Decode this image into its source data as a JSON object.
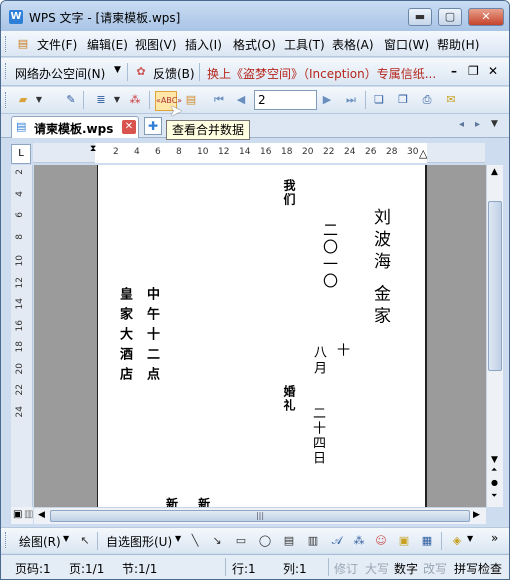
{
  "window": {
    "title": "WPS 文字 - [请柬模板.wps]",
    "app_icon_letter": "W",
    "minimize": "▬",
    "maximize": "▢",
    "close": "✕"
  },
  "menu": [
    "文件(F)",
    "编辑(E)",
    "视图(V)",
    "插入(I)",
    "格式(O)",
    "工具(T)",
    "表格(A)",
    "窗口(W)",
    "帮助(H)"
  ],
  "menu_right": {
    "minimize": "–",
    "restore": "❐",
    "close": "✕"
  },
  "online_bar": {
    "space_label": "网络办公空间(N)",
    "feedback_label": "反馈(B)",
    "promo": "换上《盗梦空间》（Inception）专属信纸..."
  },
  "mailmerge_bar": {
    "record_value": "2"
  },
  "tabs": {
    "doc_tab": "请柬模板.wps",
    "tooltip": "查看合并数据"
  },
  "ruler": {
    "ticks": [
      "2",
      "4",
      "6",
      "8",
      "10",
      "12",
      "14",
      "16",
      "18",
      "20",
      "22",
      "24",
      "26",
      "28",
      "30"
    ],
    "vticks": [
      "2",
      "4",
      "6",
      "8",
      "10",
      "12",
      "14",
      "16",
      "18",
      "20",
      "22",
      "24"
    ]
  },
  "document": {
    "line_women": "我们",
    "line_year": "二〇一〇",
    "line_names": "刘波海 金家",
    "line_month": "八月",
    "line_day": "十",
    "line_wedding": "婚礼",
    "line_date": "二十四日",
    "line_time": "中午十二点",
    "line_place": "皇家大酒店",
    "line_bottom": "新 新"
  },
  "drawbar": {
    "draw_label": "绘图(R)",
    "autoshape_label": "自选图形(U)"
  },
  "status": {
    "page_code": "页码:1",
    "page": "页:1/1",
    "section": "节:1/1",
    "row": "行:1",
    "col": "列:1",
    "rev": "修订",
    "caps": "大写",
    "num": "数字",
    "ovr": "改写",
    "spell": "拼写检查"
  }
}
